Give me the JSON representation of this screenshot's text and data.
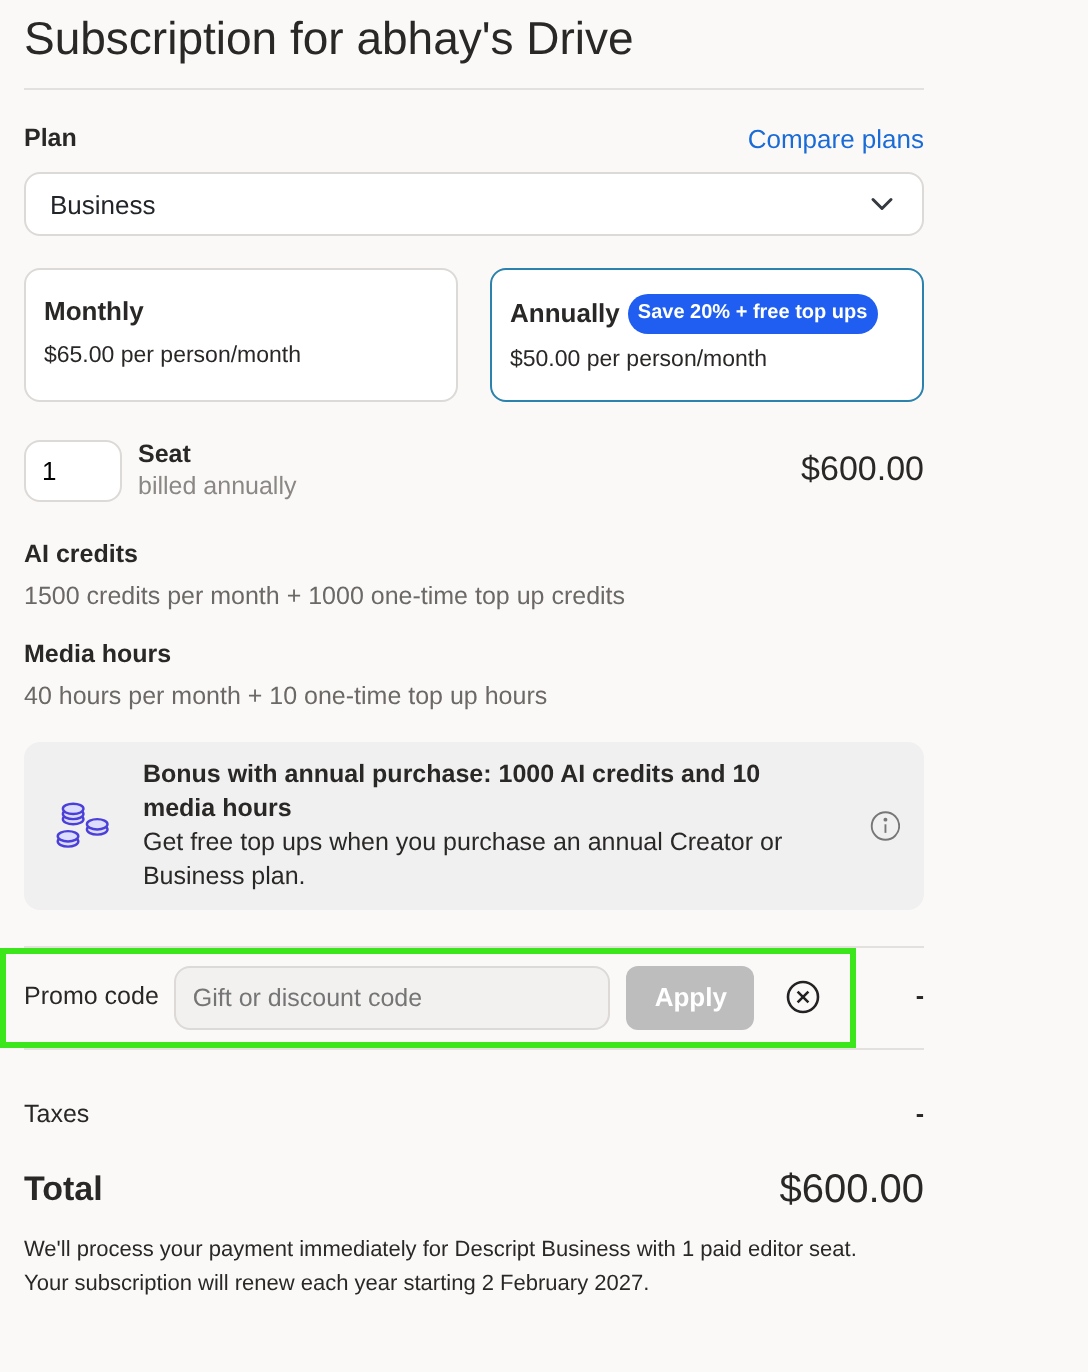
{
  "title": "Subscription for abhay's Drive",
  "plan": {
    "label": "Plan",
    "compare_link": "Compare plans",
    "value": "Business"
  },
  "billing_options": [
    {
      "name": "Monthly",
      "price": "$65.00 per person/month",
      "selected": false
    },
    {
      "name": "Annually",
      "badge": "Save 20% + free top ups",
      "price": "$50.00 per person/month",
      "selected": true
    }
  ],
  "seats": {
    "value": "1",
    "label": "Seat",
    "note": "billed annually",
    "amount": "$600.00"
  },
  "features": [
    {
      "title": "AI credits",
      "detail": "1500 credits per month + 1000 one-time top up credits"
    },
    {
      "title": "Media hours",
      "detail": "40 hours per month + 10 one-time top up hours"
    }
  ],
  "bonus": {
    "title": "Bonus with annual purchase: 1000 AI credits and 10 media hours",
    "text": "Get free top ups when you purchase an annual Creator or Business plan."
  },
  "promo": {
    "label": "Promo code",
    "placeholder": "Gift or discount code",
    "button": "Apply",
    "button_disabled": true,
    "amount": "-",
    "highlighted": true
  },
  "taxes": {
    "label": "Taxes",
    "amount": "-"
  },
  "total": {
    "label": "Total",
    "amount": "$600.00"
  },
  "note": [
    "We'll process your payment immediately for Descript Business with 1 paid editor seat.",
    "Your subscription will renew each year starting 2 February 2027."
  ]
}
